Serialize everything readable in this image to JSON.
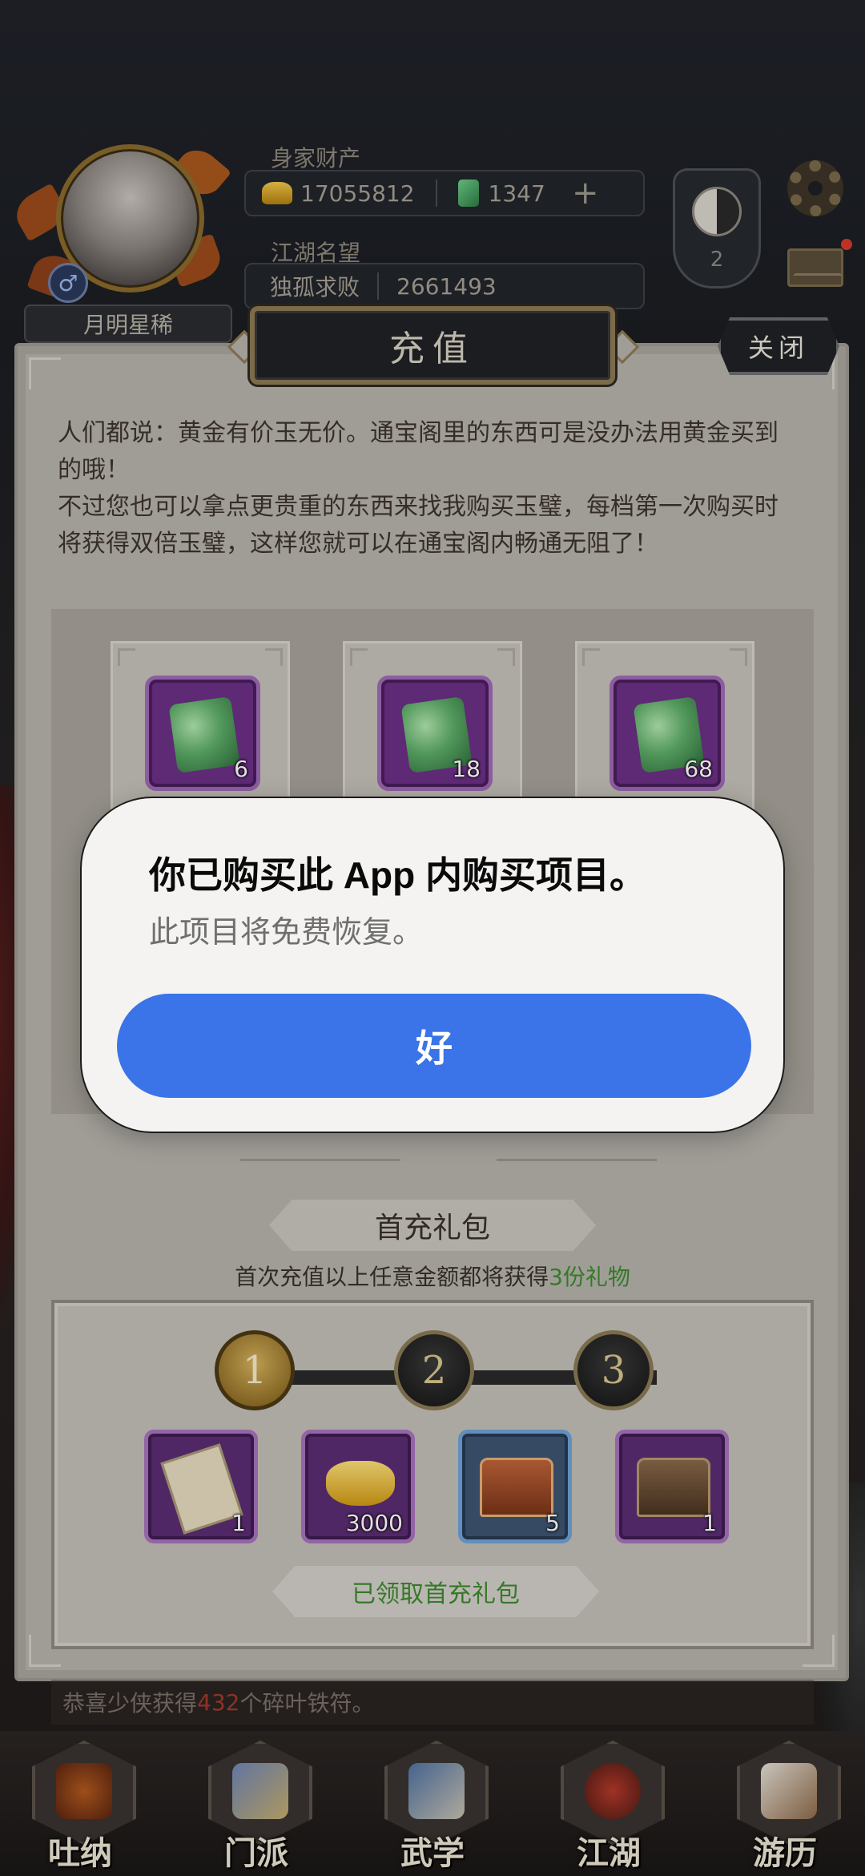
{
  "hud": {
    "player_name": "月明星稀",
    "wealth_label": "身家财产",
    "gold": "17055812",
    "jade": "1347",
    "plus": "+",
    "fame_label": "江湖名望",
    "fame_title": "独孤求败",
    "fame_value": "2661493",
    "rank_level": "2",
    "gender_symbol": "♂"
  },
  "panel": {
    "title": "充值",
    "close_label": "关闭",
    "intro_line1": "人们都说：黄金有价玉无价。通宝阁里的东西可是没办法用黄金买到的哦！",
    "intro_line2": "不过您也可以拿点更贵重的东西来找我购买玉璧，每档第一次购买时将获得双倍玉璧，这样您就可以在通宝阁内畅通无阻了！",
    "products": [
      {
        "qty": "6"
      },
      {
        "qty": "18"
      },
      {
        "qty": "68"
      }
    ],
    "first_charge_title": "首充礼包",
    "first_charge_desc_prefix": "首次充值以上任意金额都将获得",
    "first_charge_desc_highlight": "3份礼物",
    "steps": [
      "1",
      "2",
      "3"
    ],
    "rewards": [
      {
        "icon": "book-icon",
        "qty": "1"
      },
      {
        "icon": "gold-ingot-icon",
        "qty": "3000"
      },
      {
        "icon": "treasure-chest-icon",
        "qty": "5"
      },
      {
        "icon": "iron-chest-icon",
        "qty": "1"
      }
    ],
    "claimed_label": "已领取首充礼包"
  },
  "ticker": {
    "prefix": "恭喜少侠获得",
    "number": "432",
    "suffix": "个碎叶铁符。"
  },
  "nav": [
    {
      "label": "吐纳",
      "icon": "meditation-icon"
    },
    {
      "label": "门派",
      "icon": "sect-icon"
    },
    {
      "label": "武学",
      "icon": "martial-arts-icon"
    },
    {
      "label": "江湖",
      "icon": "jianghu-icon"
    },
    {
      "label": "游历",
      "icon": "travel-horse-icon"
    }
  ],
  "alert": {
    "title": "你已购买此 App 内购买项目。",
    "message": "此项目将免费恢复。",
    "ok_label": "好"
  },
  "colors": {
    "alert_button": "#3a74e8",
    "highlight_green": "#3d8a2e",
    "ticker_red": "#a13b2a"
  }
}
